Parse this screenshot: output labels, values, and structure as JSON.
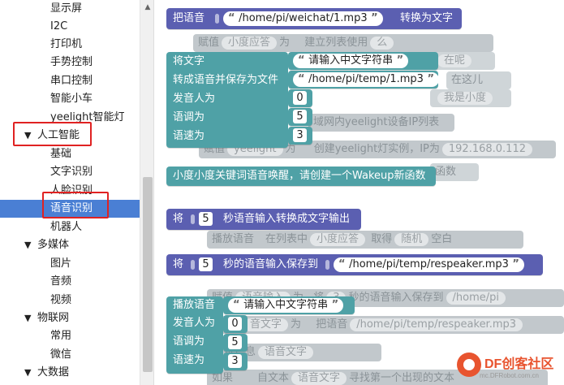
{
  "sidebar": {
    "items": [
      {
        "label": "显示屏",
        "type": "sub"
      },
      {
        "label": "I2C",
        "type": "sub"
      },
      {
        "label": "打印机",
        "type": "sub"
      },
      {
        "label": "手势控制",
        "type": "sub"
      },
      {
        "label": "串口控制",
        "type": "sub"
      },
      {
        "label": "智能小车",
        "type": "sub"
      },
      {
        "label": "yeelight智能灯",
        "type": "sub"
      },
      {
        "label": "人工智能",
        "type": "cat",
        "arrow": "▼"
      },
      {
        "label": "基础",
        "type": "sub"
      },
      {
        "label": "文字识别",
        "type": "sub"
      },
      {
        "label": "人脸识别",
        "type": "sub"
      },
      {
        "label": "语音识别",
        "type": "sub",
        "selected": true
      },
      {
        "label": "机器人",
        "type": "sub"
      },
      {
        "label": "多媒体",
        "type": "cat",
        "arrow": "▼"
      },
      {
        "label": "图片",
        "type": "sub"
      },
      {
        "label": "音频",
        "type": "sub"
      },
      {
        "label": "视频",
        "type": "sub"
      },
      {
        "label": "物联网",
        "type": "cat",
        "arrow": "▼"
      },
      {
        "label": "常用",
        "type": "sub"
      },
      {
        "label": "微信",
        "type": "sub"
      },
      {
        "label": "大数据",
        "type": "cat",
        "arrow": "▼"
      }
    ],
    "selected_color": "#4a7fd4",
    "highlight_color": "#e02222"
  },
  "workspace": {
    "ghosts": [
      {
        "t1": "赋值",
        "p1": "小度应答",
        "t2": "为",
        "t3": "建立列表使用",
        "p2": "么"
      },
      {
        "p1": "在呢"
      },
      {
        "t1": "在这儿"
      },
      {
        "p1": "我是小度"
      },
      {
        "t1": "域网内yeelight设备IP列表"
      },
      {
        "t1": "赋值",
        "p1": "yeelight",
        "t2": "为",
        "t3": "创建yeelight灯实例，IP为",
        "p2": "192.168.0.112"
      },
      {
        "t1": "函数"
      },
      {
        "t1": "播放语音",
        "t2": "在列表中",
        "p1": "小度应答",
        "t3": "取得",
        "p2": "随机",
        "t4": "空白"
      },
      {
        "t1": "赋值",
        "p1": "语音输入",
        "t2": "为",
        "t3": "将",
        "num": "3",
        "t4": "秒的语音输入保存到",
        "p2": "/home/pi"
      },
      {
        "t1": "赋值",
        "p1": "音文字",
        "t2": "为",
        "t3": "把语音",
        "p2": "/home/pi/temp/respeaker.mp3"
      },
      {
        "t1": "试信息",
        "p1": "语音文字"
      },
      {
        "t1": "如果",
        "t2": "自文本",
        "p1": "语音文字",
        "t3": "寻找第一个出现的文本"
      }
    ],
    "block1": {
      "label": "把语音",
      "path": "/home/pi/weichat/1.mp3",
      "suffix": "转换为文字"
    },
    "block2": {
      "rows": [
        {
          "label": "将文字",
          "kind": "text",
          "value": "请输入中文字符串"
        },
        {
          "label": "转成语音并保存为文件",
          "kind": "text",
          "value": "/home/pi/temp/1.mp3"
        },
        {
          "label": "发音人为",
          "kind": "num",
          "value": "0"
        },
        {
          "label": "语调为",
          "kind": "num",
          "value": "5"
        },
        {
          "label": "语速为",
          "kind": "num",
          "value": "3"
        }
      ]
    },
    "block3": {
      "label": "小度小度关键词语音唤醒，请创建一个Wakeup新函数"
    },
    "block4": {
      "label": "将",
      "num": "5",
      "suffix": "秒语音输入转换成文字输出"
    },
    "block5": {
      "label": "将",
      "num": "5",
      "suffix": "秒的语音输入保存到",
      "path": "/home/pi/temp/respeaker.mp3"
    },
    "block6": {
      "rows": [
        {
          "label": "播放语音",
          "kind": "text",
          "value": "请输入中文字符串"
        },
        {
          "label": "发音人为",
          "kind": "num",
          "value": "0"
        },
        {
          "label": "语调为",
          "kind": "num",
          "value": "5"
        },
        {
          "label": "语速为",
          "kind": "num",
          "value": "3"
        }
      ]
    },
    "colors": {
      "purple": "#5b5fb1",
      "teal": "#4fa1a6"
    }
  },
  "logo": {
    "name": "DF创客社区",
    "url": "mc.DFRobot.com.cn"
  }
}
